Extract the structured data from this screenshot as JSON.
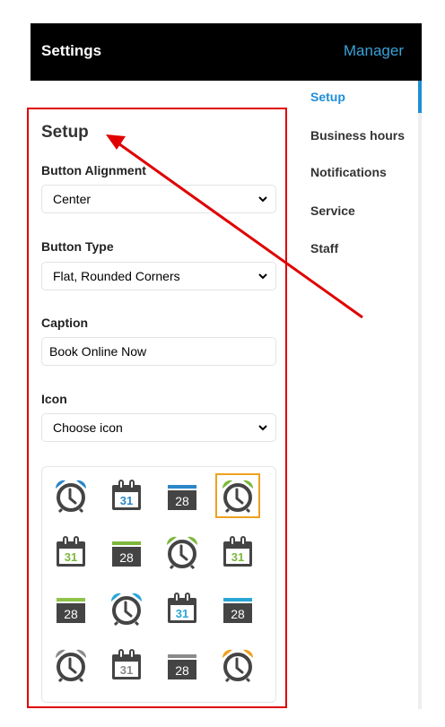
{
  "header": {
    "title": "Settings",
    "brand": "Manager"
  },
  "sidebar": {
    "items": [
      {
        "label": "Setup",
        "active": true
      },
      {
        "label": "Business hours"
      },
      {
        "label": "Notifications"
      },
      {
        "label": "Service"
      },
      {
        "label": "Staff"
      }
    ]
  },
  "panel": {
    "title": "Setup",
    "button_alignment": {
      "label": "Button Alignment",
      "value": "Center"
    },
    "button_type": {
      "label": "Button Type",
      "value": "Flat, Rounded Corners"
    },
    "caption": {
      "label": "Caption",
      "value": "Book Online Now"
    },
    "icon": {
      "label": "Icon",
      "value": "Choose icon"
    }
  },
  "icons": {
    "selected_index": 3,
    "items": [
      {
        "name": "alarm-clock-icon",
        "color": "#2c86c8"
      },
      {
        "name": "calendar-31-icon",
        "color": "#2c86c8",
        "text": "31"
      },
      {
        "name": "calendar-28-icon",
        "color": "#2c86c8",
        "text": "28"
      },
      {
        "name": "alarm-clock-icon",
        "color": "#7cb83c"
      },
      {
        "name": "calendar-31-icon",
        "color": "#7cb83c",
        "text": "31"
      },
      {
        "name": "calendar-28-icon",
        "color": "#7cb83c",
        "text": "28"
      },
      {
        "name": "alarm-clock-icon",
        "color": "#7cb83c"
      },
      {
        "name": "calendar-31-icon",
        "color": "#7cb83c",
        "text": "31"
      },
      {
        "name": "calendar-28-icon",
        "color": "#8fc34a",
        "text": "28"
      },
      {
        "name": "alarm-clock-icon",
        "color": "#2aa6d6"
      },
      {
        "name": "calendar-31-icon",
        "color": "#2aa6d6",
        "text": "31"
      },
      {
        "name": "calendar-28-icon",
        "color": "#2aa6d6",
        "text": "28"
      },
      {
        "name": "alarm-clock-icon",
        "color": "#8a8a8a"
      },
      {
        "name": "calendar-31-icon",
        "color": "#8a8a8a",
        "text": "31"
      },
      {
        "name": "calendar-28-icon",
        "color": "#8a8a8a",
        "text": "28"
      },
      {
        "name": "alarm-clock-icon",
        "color": "#f0a020"
      }
    ]
  },
  "annotation": {
    "color": "#e00000"
  }
}
